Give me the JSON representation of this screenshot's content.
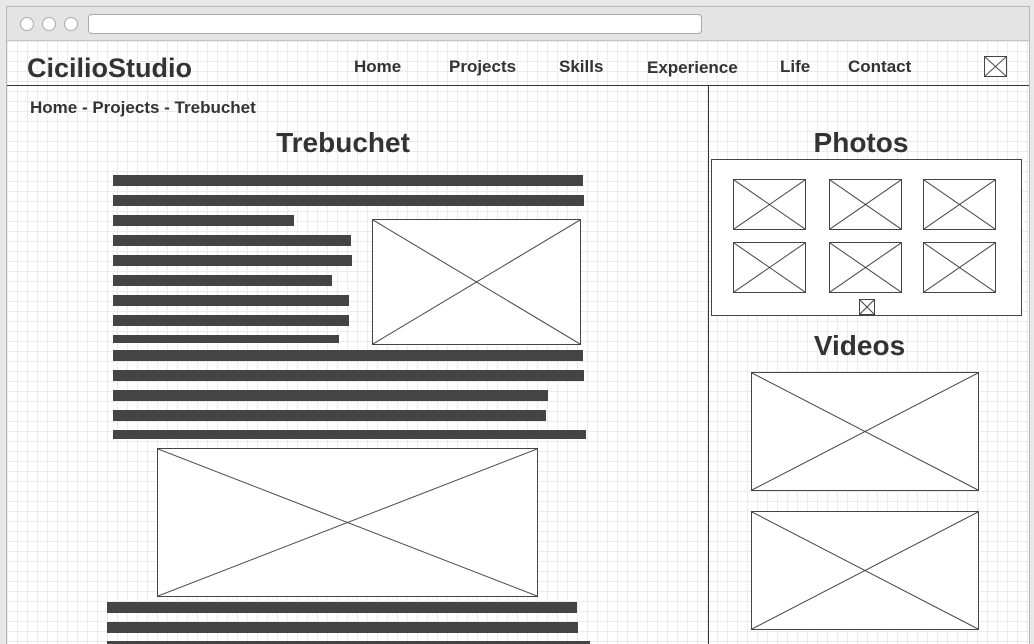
{
  "header": {
    "brand": "CicilioStudio",
    "nav": [
      {
        "label": "Home"
      },
      {
        "label": "Projects"
      },
      {
        "label": "Skills"
      },
      {
        "label": "Experience"
      },
      {
        "label": "Life"
      },
      {
        "label": "Contact"
      }
    ],
    "menu_icon": "image-placeholder-icon"
  },
  "breadcrumb": {
    "items": [
      "Home",
      "Projects",
      "Trebuchet"
    ],
    "separator": " - "
  },
  "main": {
    "title": "Trebuchet",
    "text_block_color": "#444444",
    "image_placeholder_icon": "image-placeholder-icon"
  },
  "sidebar": {
    "photos_title": "Photos",
    "photos_more_icon": "image-placeholder-icon",
    "videos_title": "Videos"
  },
  "colors": {
    "ink": "#333333",
    "grid": "#ebebeb",
    "chrome": "#e4e4e4"
  }
}
